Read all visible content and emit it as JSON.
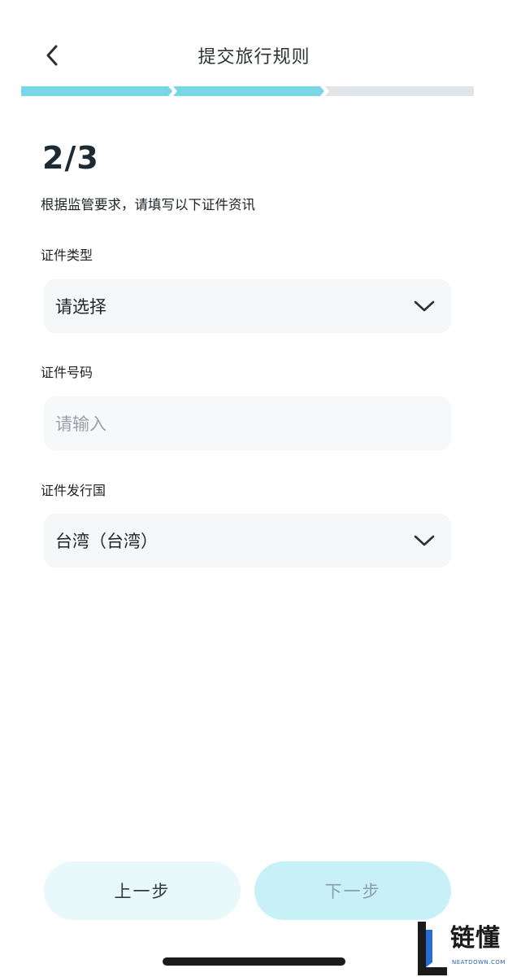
{
  "header": {
    "title": "提交旅行规则",
    "back_icon": "chevron-left-icon"
  },
  "progress": {
    "total_segments": 3,
    "completed_segments": 2,
    "active_color": "#79d6e6",
    "inactive_color": "#e1e5e7"
  },
  "step": {
    "counter": "2/3",
    "instruction": "根据监管要求，请填写以下证件资讯"
  },
  "fields": {
    "id_type": {
      "label": "证件类型",
      "value": "请选择",
      "icon": "chevron-down-icon"
    },
    "id_number": {
      "label": "证件号码",
      "value": "",
      "placeholder": "请输入"
    },
    "issuing_country": {
      "label": "证件发行国",
      "value": "台湾（台湾）",
      "icon": "chevron-down-icon"
    }
  },
  "buttons": {
    "prev_label": "上一步",
    "next_label": "下一步"
  },
  "watermark": {
    "text": "链懂",
    "subtext": "NEATDOWN.COM"
  }
}
